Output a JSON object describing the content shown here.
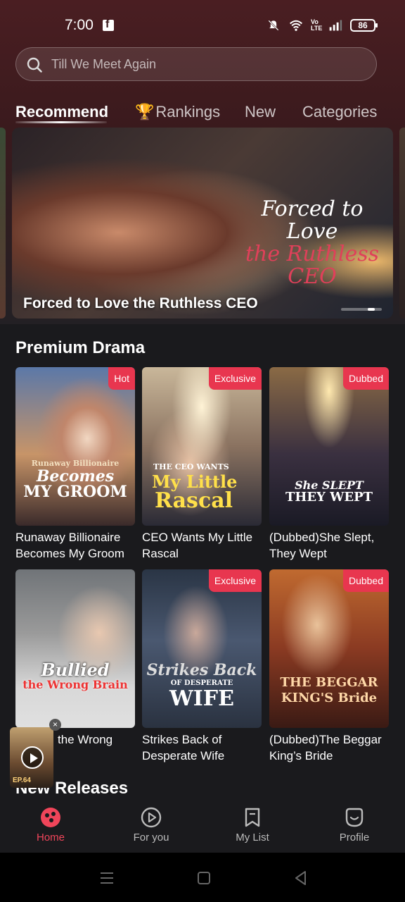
{
  "status_bar": {
    "time": "7:00",
    "battery": "86",
    "volte": "Vo LTE"
  },
  "search": {
    "placeholder": "Till We Meet Again"
  },
  "tabs": [
    {
      "label": "Recommend",
      "active": true
    },
    {
      "label": "Rankings",
      "active": false
    },
    {
      "label": "New",
      "active": false
    },
    {
      "label": "Categories",
      "active": false
    }
  ],
  "banner": {
    "logo_line1": "Forced to Love",
    "logo_line2": "the Ruthless CEO",
    "title": "Forced to Love the Ruthless CEO",
    "slide_active": 4
  },
  "premium": {
    "title": "Premium Drama",
    "cards": [
      {
        "badge": "Hot",
        "poster_text_1": "Runaway Billionaire",
        "poster_text_2": "Becomes",
        "poster_text_3": "MY GROOM",
        "title": "Runaway Billionaire Becomes My Groom"
      },
      {
        "badge": "Exclusive",
        "poster_text_1": "THE CEO WANTS",
        "poster_text_2": "My Little",
        "poster_text_3": "Rascal",
        "title": "CEO Wants My Little Rascal"
      },
      {
        "badge": "Dubbed",
        "poster_text_1": "",
        "poster_text_2": "She SLEPT",
        "poster_text_3": "THEY WEPT",
        "title": "(Dubbed)She Slept, They Wept"
      },
      {
        "badge": "",
        "poster_text_1": "",
        "poster_text_2": "Bullied",
        "poster_text_3": "the Wrong Brain",
        "title": "the Wrong"
      },
      {
        "badge": "Exclusive",
        "poster_text_1": "Strikes Back",
        "poster_text_2": "OF DESPERATE",
        "poster_text_3": "WIFE",
        "title": "Strikes Back of Desperate Wife"
      },
      {
        "badge": "Dubbed",
        "poster_text_1": "",
        "poster_text_2": "THE BEGGAR",
        "poster_text_3": "KING'S Bride",
        "title": "(Dubbed)The Beggar King’s Bride"
      }
    ]
  },
  "new_releases": {
    "title": "New Releases"
  },
  "mini_player": {
    "episode": "EP.64",
    "close": "×"
  },
  "bottom_nav": [
    {
      "label": "Home",
      "icon": "home-icon",
      "active": true
    },
    {
      "label": "For you",
      "icon": "play-circle-icon",
      "active": false
    },
    {
      "label": "My List",
      "icon": "bookmark-icon",
      "active": false
    },
    {
      "label": "Profile",
      "icon": "profile-icon",
      "active": false
    }
  ],
  "colors": {
    "accent": "#f0455a",
    "badge": "#e8364f",
    "trophy": "#e6a82c"
  }
}
